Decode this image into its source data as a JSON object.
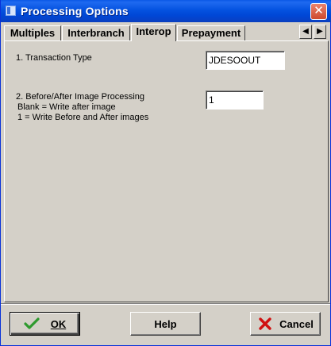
{
  "window": {
    "title": "Processing Options",
    "close_glyph": "✕"
  },
  "tabs": [
    {
      "label": "Multiples",
      "active": false
    },
    {
      "label": "Interbranch",
      "active": false
    },
    {
      "label": "Interop",
      "active": true
    },
    {
      "label": "Prepayment",
      "active": false
    }
  ],
  "tab_nav": {
    "prev": "◀",
    "next": "▶"
  },
  "options": {
    "transaction_type": {
      "label": "1. Transaction Type",
      "value": "JDESOOUT"
    },
    "image_processing": {
      "label_line1": "2. Before/After Image Processing",
      "label_line2": "Blank = Write after image",
      "label_line3": "1 = Write Before and After images",
      "value": "1"
    }
  },
  "buttons": {
    "ok": "OK",
    "help": "Help",
    "cancel": "Cancel"
  },
  "colors": {
    "titlebar": "#0452e0",
    "ok_check": "#2e9a2e",
    "cancel_x": "#d01010"
  },
  "icons": {
    "ok": "checkmark-icon",
    "cancel": "red-x-icon"
  }
}
